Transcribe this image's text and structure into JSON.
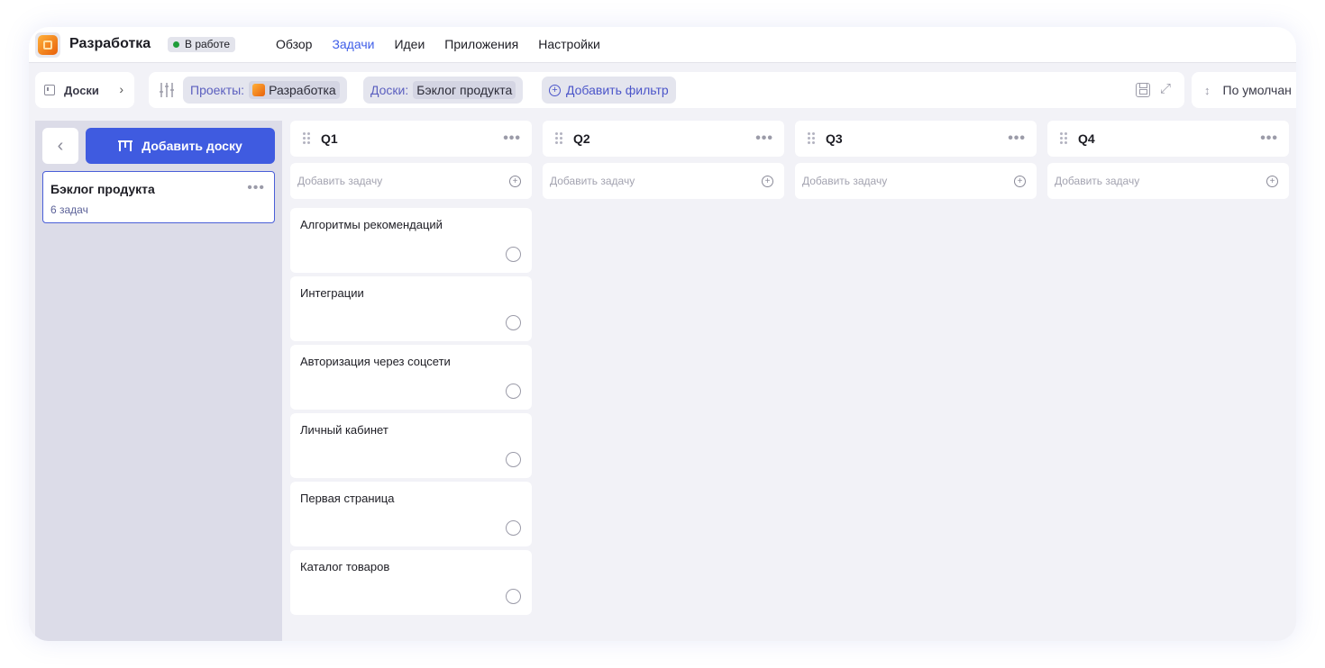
{
  "app": {
    "title": "Разработка",
    "status": "В работе",
    "status_color": "#1f9d3a",
    "accent": "#3f5be0"
  },
  "nav": [
    "Обзор",
    "Задачи",
    "Идеи",
    "Приложения",
    "Настройки"
  ],
  "nav_active": "Задачи",
  "breadcrumb": {
    "label": "Доски",
    "icon": "board-icon",
    "chevron": "chevron-right-icon"
  },
  "filters": {
    "projects_label": "Проекты:",
    "projects_value": "Разработка",
    "boards_label": "Доски:",
    "boards_value": "Бэклог продукта",
    "add_filter": "Добавить фильтр"
  },
  "sort": {
    "label": "По умолчан"
  },
  "sidebar": {
    "add_board": "Добавить доску",
    "boards": [
      {
        "name": "Бэклог продукта",
        "count": "6 задач"
      }
    ]
  },
  "columns": [
    {
      "title": "Q1",
      "add_placeholder": "Добавить задачу",
      "tasks": [
        "Алгоритмы рекомендаций",
        "Интеграции",
        "Авторизация через соцсети",
        "Личный кабинет",
        "Первая страница",
        "Каталог товаров"
      ]
    },
    {
      "title": "Q2",
      "add_placeholder": "Добавить задачу",
      "tasks": []
    },
    {
      "title": "Q3",
      "add_placeholder": "Добавить задачу",
      "tasks": []
    },
    {
      "title": "Q4",
      "add_placeholder": "Добавить задачу",
      "tasks": []
    }
  ]
}
